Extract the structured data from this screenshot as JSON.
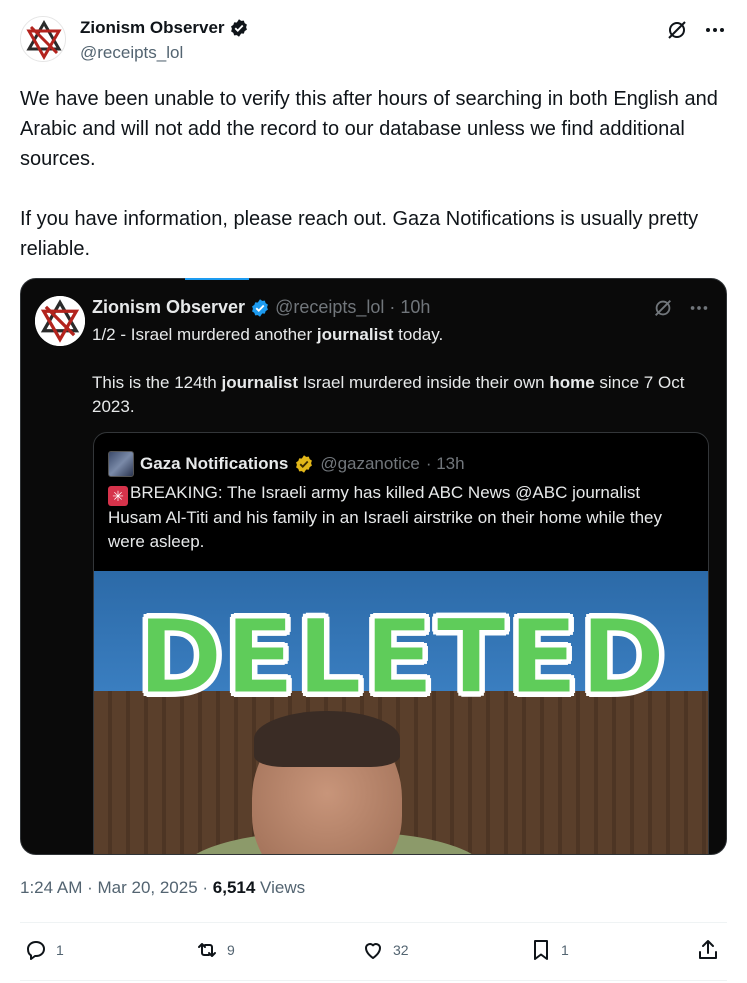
{
  "author": {
    "display_name": "Zionism Observer",
    "handle": "@receipts_lol",
    "verified": true
  },
  "tweet": {
    "paragraph1": "We have been unable to verify this after hours of searching in both English and Arabic and will not add the record to our database unless we find additional sources.",
    "paragraph2": "If you have information, please reach out. Gaza Notifications is usually pretty reliable."
  },
  "quoted": {
    "display_name": "Zionism Observer",
    "handle": "@receipts_lol",
    "time": "· 10h",
    "line1_a": "1/2 - Israel murdered another ",
    "line1_b": "journalist",
    "line1_c": " today.",
    "line2_a": "This is the 124th ",
    "line2_b": "journalist",
    "line2_c": " Israel murdered inside their own ",
    "line2_d": "home",
    "line2_e": " since 7 Oct 2023.",
    "inner": {
      "display_name": "Gaza Notifications",
      "handle": "@gazanotice",
      "time": "· 13h",
      "text": "BREAKING: The Israeli army has killed ABC News @ABC journalist Husam Al-Titi and his family in an Israeli airstrike on their home while they were asleep.",
      "overlay": "DELETED"
    }
  },
  "meta": {
    "time": "1:24 AM",
    "sep1": " · ",
    "date": "Mar 20, 2025",
    "sep2": " · ",
    "views_count": "6,514",
    "views_label": " Views"
  },
  "actions": {
    "replies": "1",
    "reposts": "9",
    "likes": "32",
    "bookmarks": "1"
  },
  "colors": {
    "verified_blue": "#1d9bf0",
    "verified_gold": "#e2b719",
    "deleted_green": "#5fcc5a"
  }
}
